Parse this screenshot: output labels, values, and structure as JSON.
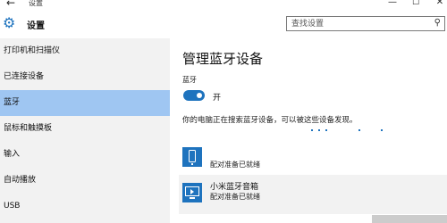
{
  "window": {
    "back_icon": "back-arrow-icon",
    "title": "设置",
    "controls": [
      "minimize",
      "maximize",
      "close"
    ]
  },
  "header": {
    "app_title": "设置",
    "app_icon": "gear-icon",
    "search_placeholder": "查找设置",
    "search_icon": "search-icon"
  },
  "sidebar": {
    "items": [
      {
        "label": "打印机和扫描仪",
        "selected": false
      },
      {
        "label": "已连接设备",
        "selected": false
      },
      {
        "label": "蓝牙",
        "selected": true
      },
      {
        "label": "鼠标和触摸板",
        "selected": false
      },
      {
        "label": "输入",
        "selected": false
      },
      {
        "label": "自动播放",
        "selected": false
      },
      {
        "label": "USB",
        "selected": false
      }
    ]
  },
  "main": {
    "title": "管理蓝牙设备",
    "bluetooth_label": "蓝牙",
    "toggle_state": "开",
    "toggle_on": true,
    "searching_text": "你的电脑正在搜索蓝牙设备，可以被这些设备发现。",
    "devices": [
      {
        "name": "",
        "status": "配对准备已就绪",
        "icon": "phone-icon"
      },
      {
        "name": "小米蓝牙音箱",
        "status": "配对准备已就绪",
        "icon": "display-device-icon"
      }
    ]
  },
  "colors": {
    "accent": "#1e73be",
    "selected_nav": "#9fc6f2",
    "sidebar_bg": "#f2f2f2"
  }
}
